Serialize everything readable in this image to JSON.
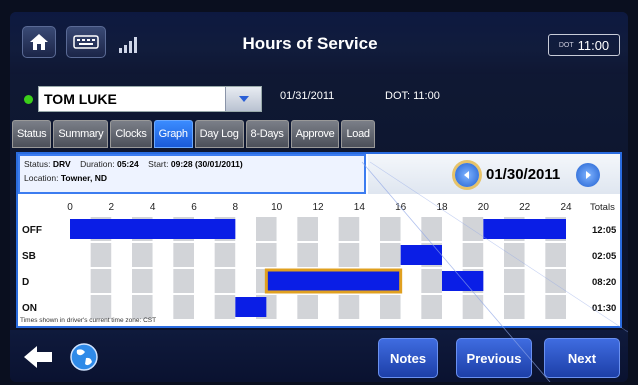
{
  "header": {
    "title": "Hours of Service",
    "clock_prefix": "DOT",
    "clock": "11:00",
    "home_icon": "home-icon",
    "keyboard_icon": "keyboard-icon",
    "signal_icon": "signal-icon"
  },
  "driver": {
    "status_color": "#3ccf1a",
    "name": "TOM LUKE",
    "date": "01/31/2011",
    "dot_time": "DOT: 11:00"
  },
  "tabs": [
    {
      "label": "Status",
      "active": false
    },
    {
      "label": "Summary",
      "active": false
    },
    {
      "label": "Clocks",
      "active": false
    },
    {
      "label": "Graph",
      "active": true
    },
    {
      "label": "Day Log",
      "active": false
    },
    {
      "label": "8-Days",
      "active": false
    },
    {
      "label": "Approve",
      "active": false
    },
    {
      "label": "Load",
      "active": false
    }
  ],
  "status_box": {
    "status_label": "Status:",
    "status_value": "DRV",
    "duration_label": "Duration:",
    "duration_value": "05:24",
    "start_label": "Start:",
    "start_value": "09:28 (30/01/2011)",
    "location_label": "Location:",
    "location_value": "Towner, ND"
  },
  "date_nav": {
    "date": "01/30/2011"
  },
  "chart_data": {
    "type": "gantt",
    "x_ticks": [
      "0",
      "2",
      "4",
      "6",
      "8",
      "10",
      "12",
      "14",
      "16",
      "18",
      "20",
      "22",
      "24"
    ],
    "xlim": [
      0,
      24
    ],
    "rows": [
      "OFF",
      "SB",
      "D",
      "ON"
    ],
    "totals_label": "Totals",
    "totals": [
      "12:05",
      "02:05",
      "08:20",
      "01:30"
    ],
    "segments": [
      {
        "row": "OFF",
        "start": 0,
        "end": 8
      },
      {
        "row": "ON",
        "start": 8,
        "end": 9.5
      },
      {
        "row": "D",
        "start": 9.5,
        "end": 16
      },
      {
        "row": "SB",
        "start": 16,
        "end": 18
      },
      {
        "row": "D",
        "start": 18,
        "end": 20
      },
      {
        "row": "OFF",
        "start": 20,
        "end": 24
      }
    ],
    "highlight": {
      "row": "D",
      "start": 9.5,
      "end": 16
    },
    "bar_color": "#0a1ee6",
    "highlight_color": "#e0a020",
    "footnote": "Times shown in driver's current time zone: CST"
  },
  "footer": {
    "back_icon": "back-arrow-icon",
    "globe_icon": "globe-icon",
    "notes": "Notes",
    "previous": "Previous",
    "next": "Next"
  }
}
